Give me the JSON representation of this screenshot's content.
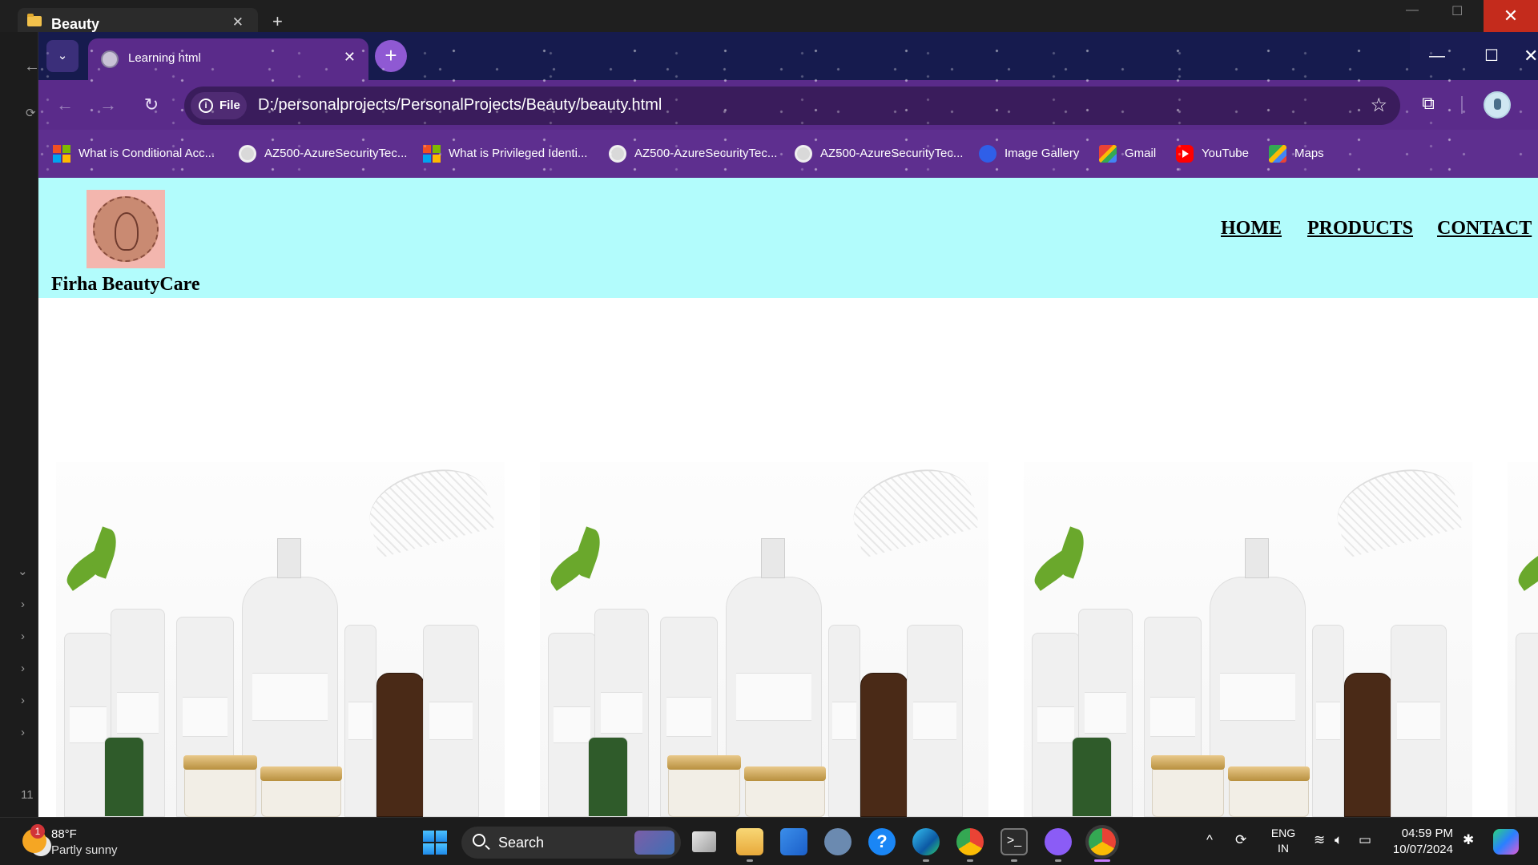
{
  "explorer": {
    "tab_title": "Beauty",
    "line_number": "11"
  },
  "browser": {
    "tab_title": "Learning html",
    "site_chip": "File",
    "url": "D:/personalprojects/PersonalProjects/Beauty/beauty.html",
    "bookmarks": [
      {
        "label": "What is Conditional Acc...",
        "icon": "microsoft-icon"
      },
      {
        "label": "AZ500-AzureSecurityTec...",
        "icon": "globe-icon"
      },
      {
        "label": "What is Privileged Identi...",
        "icon": "microsoft-icon"
      },
      {
        "label": "AZ500-AzureSecurityTec...",
        "icon": "globe-icon"
      },
      {
        "label": "AZ500-AzureSecurityTec...",
        "icon": "globe-icon"
      },
      {
        "label": "Image Gallery",
        "icon": "drop-icon"
      },
      {
        "label": "Gmail",
        "icon": "gmail-icon"
      },
      {
        "label": "YouTube",
        "icon": "youtube-icon"
      },
      {
        "label": "Maps",
        "icon": "maps-icon"
      }
    ]
  },
  "page": {
    "brand": "Firha BeautyCare",
    "nav": [
      "HOME",
      "PRODUCTS",
      "CONTACT"
    ]
  },
  "taskbar": {
    "weather_temp": "88°F",
    "weather_condition": "Partly sunny",
    "weather_badge": "1",
    "search_label": "Search",
    "lang_line1": "ENG",
    "lang_line2": "IN",
    "time": "04:59 PM",
    "date": "10/07/2024"
  },
  "colors": {
    "header_bg": "#b2fcfc",
    "browser_toolbar": "#5a2b8a",
    "tabstrip": "#161b4e"
  }
}
